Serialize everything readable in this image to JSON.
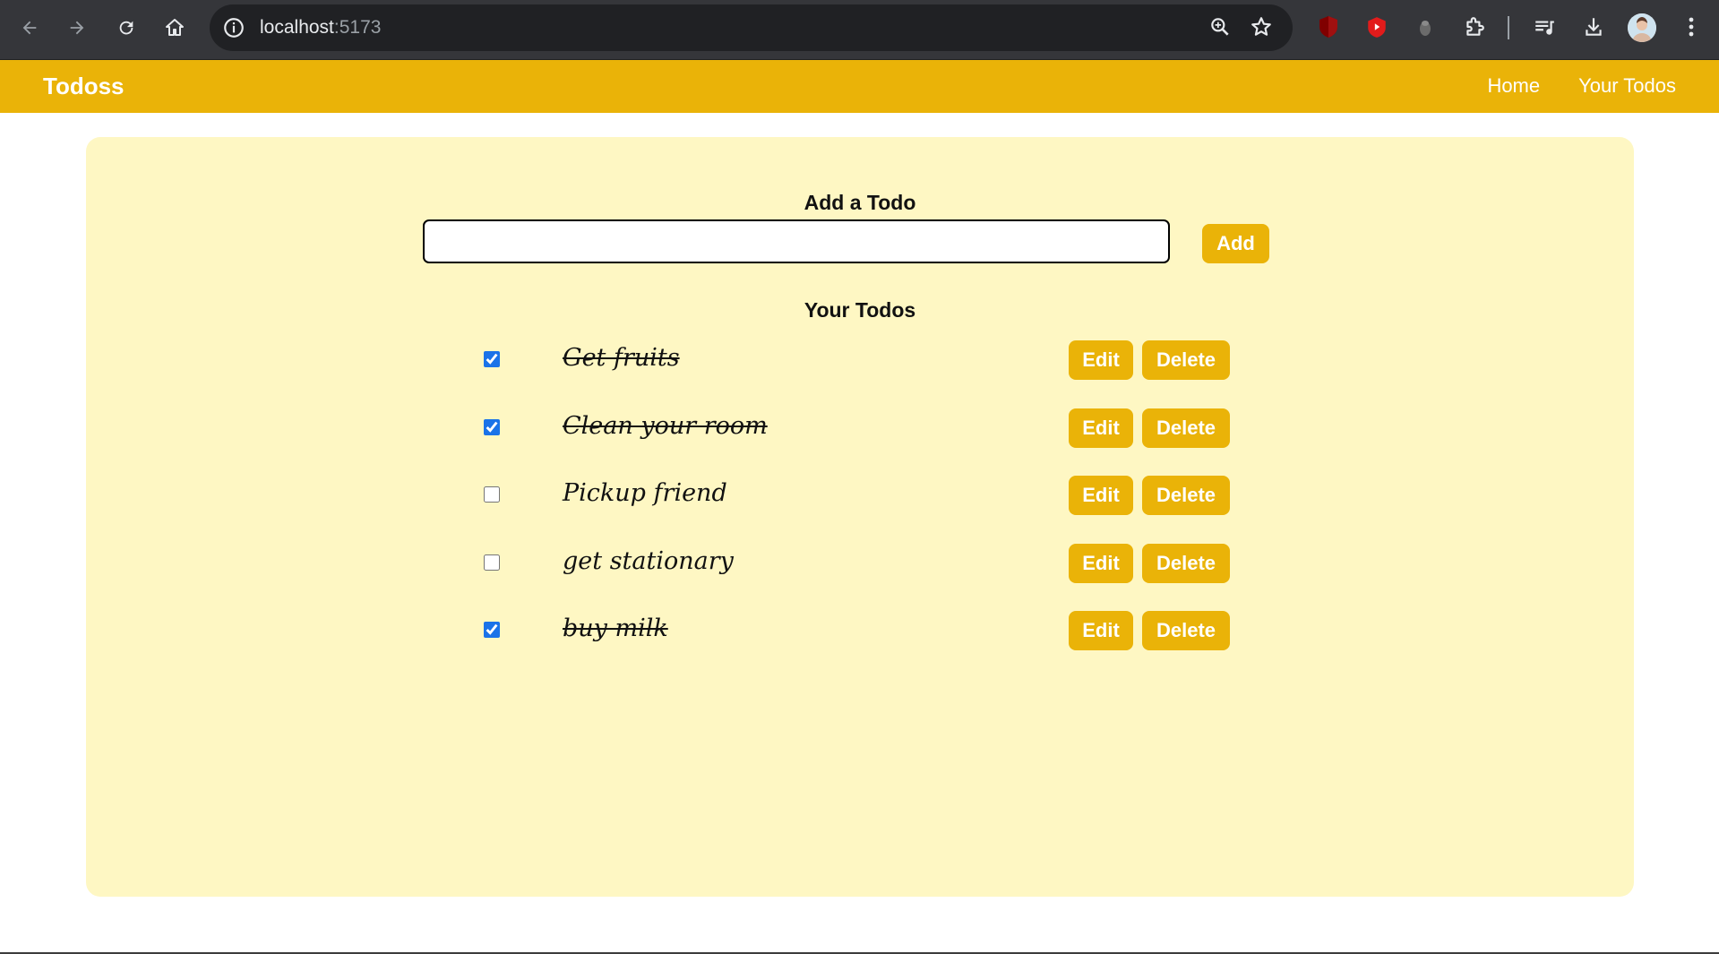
{
  "browser": {
    "url_host": "localhost",
    "url_port": ":5173"
  },
  "app": {
    "brand": "Todoss",
    "nav": [
      "Home",
      "Your Todos"
    ],
    "accent_color": "#eab308",
    "card_color": "#fef7c3"
  },
  "form": {
    "heading": "Add a Todo",
    "input_value": "",
    "add_label": "Add"
  },
  "list": {
    "heading": "Your Todos",
    "edit_label": "Edit",
    "delete_label": "Delete",
    "items": [
      {
        "text": "Get fruits",
        "done": true
      },
      {
        "text": "Clean your room",
        "done": true
      },
      {
        "text": "Pickup friend",
        "done": false
      },
      {
        "text": "get stationary",
        "done": false
      },
      {
        "text": "buy milk",
        "done": true
      }
    ]
  }
}
